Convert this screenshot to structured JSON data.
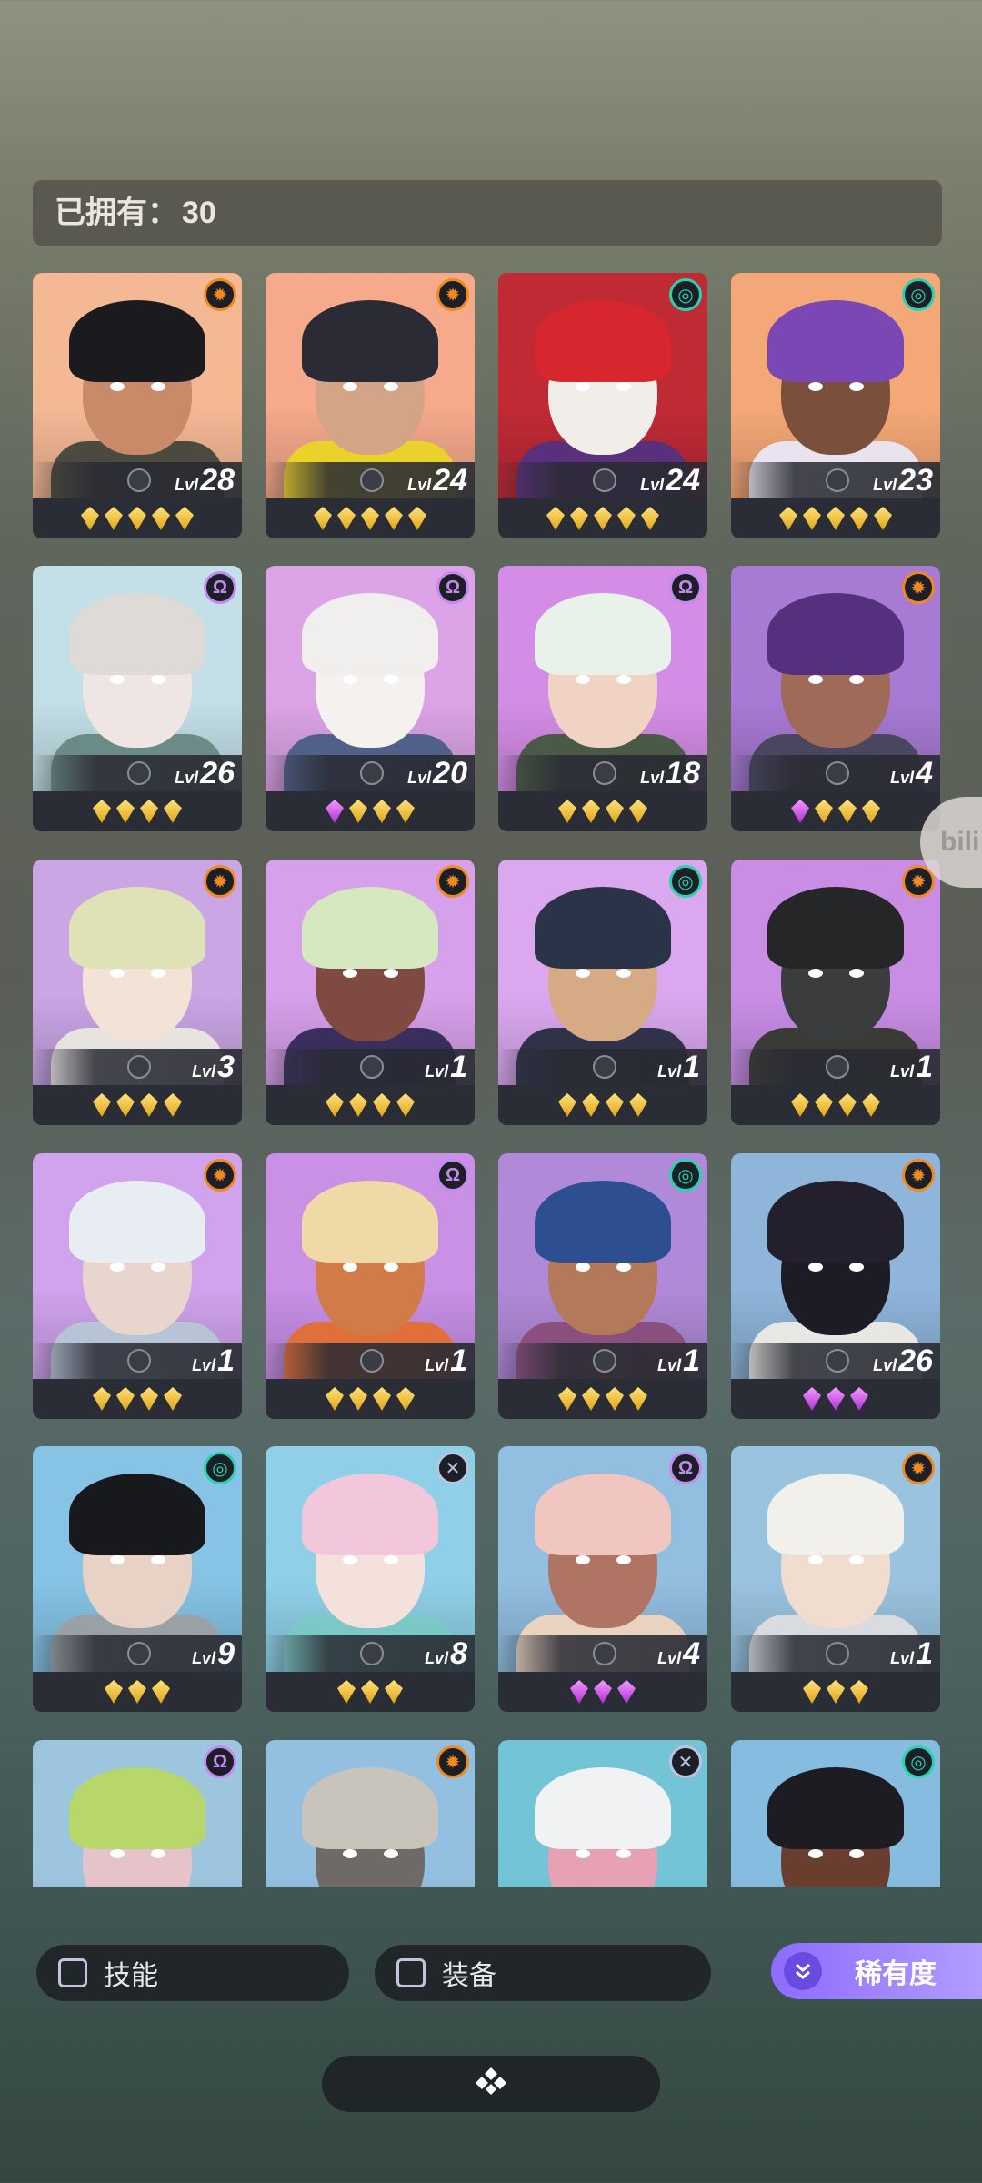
{
  "owned": {
    "label": "已拥有：",
    "count": "30"
  },
  "colors": {
    "orange": "#f08a1e",
    "teal": "#27d3b0",
    "purple": "#c58af0",
    "cross": "#b9c4e0"
  },
  "cards": [
    {
      "level": "28",
      "element": "sun",
      "gems": [
        "gold",
        "gold",
        "gold",
        "gold",
        "gold"
      ],
      "bg": "#f5b895",
      "skin": "#c98a6a",
      "hair": "#1b1b1f",
      "cloth": "#4a4a3f"
    },
    {
      "level": "24",
      "element": "sun",
      "gems": [
        "gold",
        "gold",
        "gold",
        "gold",
        "gold"
      ],
      "bg": "#f6a98b",
      "skin": "#d3a485",
      "hair": "#2a2b35",
      "cloth": "#e9d22a"
    },
    {
      "level": "24",
      "element": "swirl",
      "gems": [
        "gold",
        "gold",
        "gold",
        "gold",
        "gold"
      ],
      "bg": "#c02a35",
      "skin": "#f1ede9",
      "hair": "#d8262e",
      "cloth": "#5a2f7c"
    },
    {
      "level": "23",
      "element": "swirl",
      "gems": [
        "gold",
        "gold",
        "gold",
        "gold",
        "gold"
      ],
      "bg": "#f5a877",
      "skin": "#7a4f3c",
      "hair": "#7a47b4",
      "cloth": "#e8e3ee"
    },
    {
      "level": "26",
      "element": "omega",
      "gems": [
        "gold",
        "gold",
        "gold",
        "gold"
      ],
      "bg": "#c3dfe7",
      "skin": "#efe6e3",
      "hair": "#dedad6",
      "cloth": "#6b8b86"
    },
    {
      "level": "20",
      "element": "omega",
      "gems": [
        "purple",
        "gold",
        "gold",
        "gold"
      ],
      "bg": "#dca4e6",
      "skin": "#f5f1ef",
      "hair": "#f1efee",
      "cloth": "#506088"
    },
    {
      "level": "18",
      "element": "omega",
      "gems": [
        "gold",
        "gold",
        "gold",
        "gold"
      ],
      "bg": "#d48de6",
      "skin": "#f0d3c3",
      "hair": "#e9f1eb",
      "cloth": "#4b5a46"
    },
    {
      "level": "4",
      "element": "sun",
      "gems": [
        "purple",
        "gold",
        "gold",
        "gold"
      ],
      "bg": "#a77ad4",
      "skin": "#9f6a58",
      "hair": "#55307e",
      "cloth": "#4a4660"
    },
    {
      "level": "3",
      "element": "sun",
      "gems": [
        "gold",
        "gold",
        "gold",
        "gold"
      ],
      "bg": "#caa6e4",
      "skin": "#f3e2d6",
      "hair": "#dfe1b6",
      "cloth": "#e7e3df"
    },
    {
      "level": "1",
      "element": "sun",
      "gems": [
        "gold",
        "gold",
        "gold",
        "gold"
      ],
      "bg": "#d7a0ea",
      "skin": "#7f4a42",
      "hair": "#d6e8c0",
      "cloth": "#3a2f5c"
    },
    {
      "level": "1",
      "element": "swirl",
      "gems": [
        "gold",
        "gold",
        "gold",
        "gold"
      ],
      "bg": "#dba8f0",
      "skin": "#d6aa84",
      "hair": "#2b3348",
      "cloth": "#2f3248"
    },
    {
      "level": "1",
      "element": "sun",
      "gems": [
        "gold",
        "gold",
        "gold",
        "gold"
      ],
      "bg": "#c98de6",
      "skin": "#3a3c3d",
      "hair": "#252628",
      "cloth": "#3a3a36"
    },
    {
      "level": "1",
      "element": "sun",
      "gems": [
        "gold",
        "gold",
        "gold",
        "gold"
      ],
      "bg": "#d0a3ec",
      "skin": "#e8d6ce",
      "hair": "#e7edf3",
      "cloth": "#b7c3d6"
    },
    {
      "level": "1",
      "element": "omega",
      "gems": [
        "gold",
        "gold",
        "gold",
        "gold"
      ],
      "bg": "#c990e6",
      "skin": "#d07b48",
      "hair": "#efd9a6",
      "cloth": "#e06f3a"
    },
    {
      "level": "1",
      "element": "swirl",
      "gems": [
        "gold",
        "gold",
        "gold",
        "gold"
      ],
      "bg": "#b08ad8",
      "skin": "#b4785a",
      "hair": "#2d4f91",
      "cloth": "#8a4f7e"
    },
    {
      "level": "26",
      "element": "sun",
      "gems": [
        "purple",
        "purple",
        "purple"
      ],
      "bg": "#8fb5da",
      "skin": "#1d1c26",
      "hair": "#231f2c",
      "cloth": "#e9e7e4"
    },
    {
      "level": "9",
      "element": "swirl",
      "gems": [
        "gold",
        "gold",
        "gold"
      ],
      "bg": "#86c3e5",
      "skin": "#e8d2c6",
      "hair": "#18191c",
      "cloth": "#9aa1a6"
    },
    {
      "level": "8",
      "element": "cross",
      "gems": [
        "gold",
        "gold",
        "gold"
      ],
      "bg": "#8fd0e8",
      "skin": "#f5e1db",
      "hair": "#f2c7db",
      "cloth": "#7cc8c6"
    },
    {
      "level": "4",
      "element": "omega",
      "gems": [
        "purple",
        "purple",
        "purple"
      ],
      "bg": "#92bee0",
      "skin": "#b07465",
      "hair": "#f1c6c1",
      "cloth": "#e9d4c2"
    },
    {
      "level": "1",
      "element": "sun",
      "gems": [
        "gold",
        "gold",
        "gold"
      ],
      "bg": "#9ac3e0",
      "skin": "#f1dcd0",
      "hair": "#f1f0ea",
      "cloth": "#d9dbe1"
    },
    {
      "level": "",
      "element": "omega",
      "gems": [],
      "bg": "#9ec5de",
      "skin": "#e6c3c8",
      "hair": "#b8d76a",
      "cloth": "#6b4a8a"
    },
    {
      "level": "",
      "element": "sun",
      "gems": [],
      "bg": "#93bfe0",
      "skin": "#6f6a68",
      "hair": "#c8c4bb",
      "cloth": "#3b3a3f"
    },
    {
      "level": "",
      "element": "cross",
      "gems": [],
      "bg": "#74c4d8",
      "skin": "#e6a1b5",
      "hair": "#f1f2f4",
      "cloth": "#4fa3b7"
    },
    {
      "level": "",
      "element": "swirl",
      "gems": [],
      "bg": "#86bce0",
      "skin": "#6a3e2e",
      "hair": "#1c1c22",
      "cloth": "#3b2b2a"
    }
  ],
  "filters": {
    "skill": "技能",
    "equip": "装备",
    "rarity": "稀有度"
  },
  "side_tab": "bili",
  "icons": {
    "rarity": "chevron-double-down-icon",
    "bottom": "diamond-cluster-icon"
  }
}
